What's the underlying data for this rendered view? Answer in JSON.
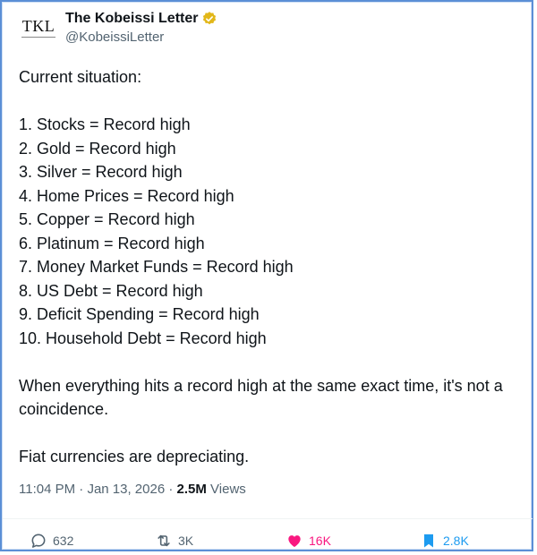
{
  "author": {
    "display_name": "The Kobeissi Letter",
    "handle": "@KobeissiLetter",
    "avatar_text": "TKL",
    "badge_icon": "verified-gold-badge-icon",
    "badge_color": "#e2b719"
  },
  "post": {
    "intro": "Current situation:",
    "items": [
      "1. Stocks = Record high",
      "2. Gold = Record high",
      "3. Silver = Record high",
      "4. Home Prices = Record high",
      "5. Copper = Record high",
      "6. Platinum = Record high",
      "7. Money Market Funds = Record high",
      "8. US Debt = Record high",
      "9. Deficit Spending = Record high",
      "10. Household Debt = Record high"
    ],
    "paragraph1": "When everything hits a record high at the same exact time, it's not a coincidence.",
    "paragraph2": "Fiat currencies are depreciating."
  },
  "meta": {
    "time": "11:04 PM",
    "separator1": " · ",
    "date": "Jan 13, 2026",
    "separator2": " · ",
    "views_count": "2.5M",
    "views_label": " Views"
  },
  "actions": {
    "replies": "632",
    "reposts": "3K",
    "likes": "16K",
    "bookmarks": "2.8K"
  },
  "colors": {
    "like": "#f91880",
    "bookmark": "#1d9bf0",
    "muted": "#536471",
    "frame": "#5b8fd6"
  }
}
